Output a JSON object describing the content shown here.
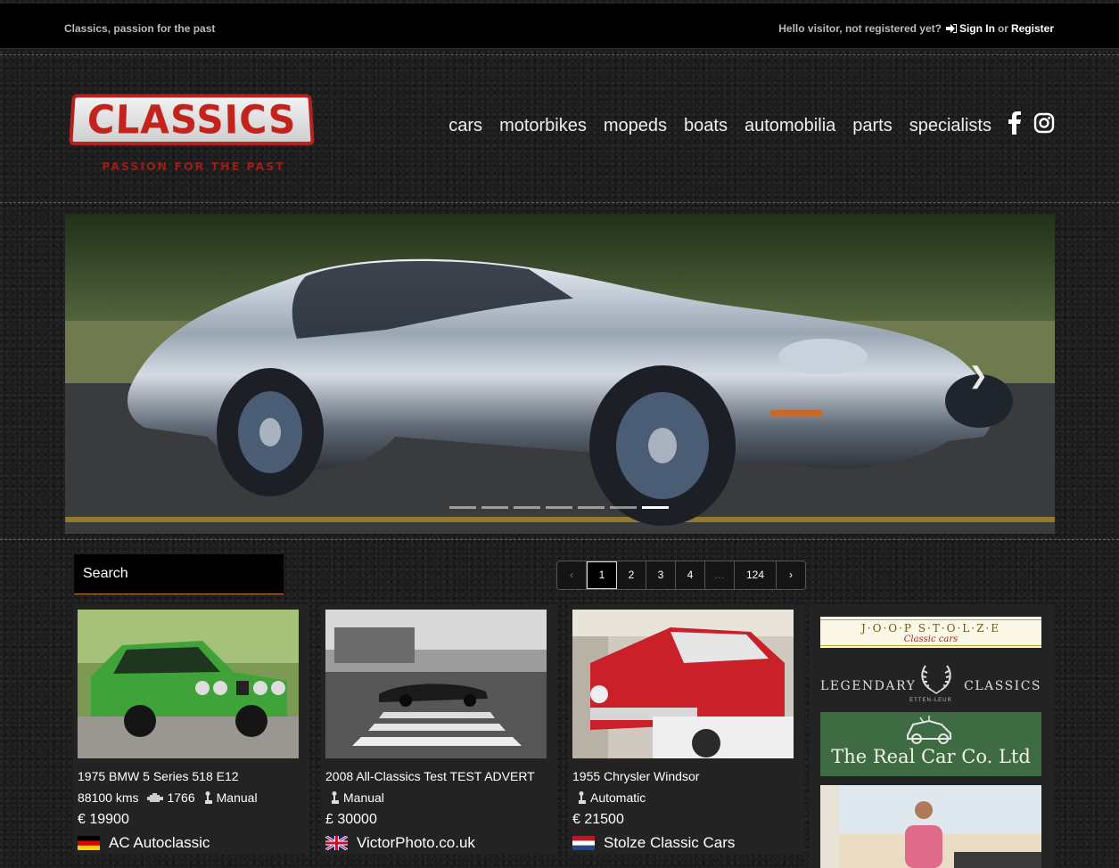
{
  "topbar": {
    "tagline": "Classics, passion for the past",
    "greeting": "Hello visitor, not registered yet?",
    "signin": "Sign In",
    "or": "or",
    "register": "Register"
  },
  "logo": {
    "text": "CLASSICS",
    "sub": "PASSION FOR THE PAST"
  },
  "nav": [
    "cars",
    "motorbikes",
    "mopeds",
    "boats",
    "automobilia",
    "parts",
    "specialists"
  ],
  "hero": {
    "slides": 7,
    "active_slide": 7
  },
  "search": {
    "label": "Search"
  },
  "pagination": {
    "prev": "‹",
    "pages": [
      "1",
      "2",
      "3",
      "4"
    ],
    "ellipsis": "…",
    "last": "124",
    "next": "›",
    "current": "1"
  },
  "listings": [
    {
      "title": "1975 BMW 5 Series 518 E12",
      "kms": "88100 kms",
      "cc": "1766",
      "gearbox": "Manual",
      "price": "€ 19900",
      "dealer": "AC Autoclassic",
      "flag": "de"
    },
    {
      "title": "2008 All-Classics Test TEST ADVERT",
      "gearbox": "Manual",
      "price": "£ 30000",
      "dealer": "VictorPhoto.co.uk",
      "flag": "gb"
    },
    {
      "title": "1955 Chrysler Windsor",
      "gearbox": "Automatic",
      "price": "€ 21500",
      "dealer": "Stolze Classic Cars",
      "flag": "nl"
    }
  ],
  "sponsors": {
    "joop": "J·O·O·P  S·T·O·L·Z·E",
    "joop_sub": "Classic cars",
    "legendary_left": "LEGENDARY",
    "legendary_right": "CLASSICS",
    "legendary_sub": "ETTEN-LEUR",
    "realcar": "The Real Car Co. Ltd"
  },
  "colors": {
    "accent": "#c97a2a",
    "logo_red": "#c2231d",
    "card_bg": "#232323"
  }
}
